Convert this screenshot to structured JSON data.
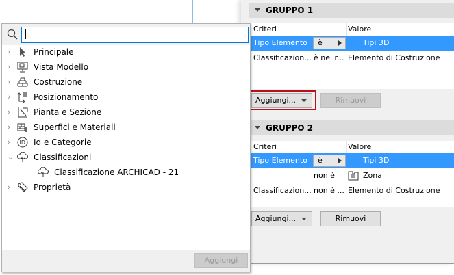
{
  "search": {
    "value": "",
    "placeholder": ""
  },
  "tree": [
    {
      "label": "Principale",
      "icon": "cursor-icon",
      "expanded": false
    },
    {
      "label": "Vista Modello",
      "icon": "monitor-icon",
      "expanded": false
    },
    {
      "label": "Costruzione",
      "icon": "bricks-icon",
      "expanded": false
    },
    {
      "label": "Posizionamento",
      "icon": "position-icon",
      "expanded": false
    },
    {
      "label": "Pianta e Sezione",
      "icon": "plan-section-icon",
      "expanded": false
    },
    {
      "label": "Superfici e Materiali",
      "icon": "materials-icon",
      "expanded": false
    },
    {
      "label": "Id e Categorie",
      "icon": "id-icon",
      "expanded": false
    },
    {
      "label": "Classificazioni",
      "icon": "tree-icon",
      "expanded": true
    },
    {
      "label": "Classificazione ARCHICAD - 21",
      "icon": "tree-icon",
      "child": true
    },
    {
      "label": "Proprietà",
      "icon": "tag-icon",
      "expanded": false
    }
  ],
  "popup_add": "Aggiungi",
  "groups": [
    {
      "title": "GRUPPO 1",
      "headers": [
        "Criteri",
        "",
        "Valore"
      ],
      "rows": [
        [
          "Tipo Elemento",
          "è",
          "Tipi 3D"
        ],
        [
          "Classificazion...",
          "è nel r...",
          "Elemento di Costruzione"
        ]
      ],
      "add": "Aggiungi...",
      "remove": "Rimuovi"
    },
    {
      "title": "GRUPPO 2",
      "headers": [
        "Criteri",
        "",
        "Valore"
      ],
      "rows": [
        [
          "Tipo Elemento",
          "è",
          "Tipi 3D"
        ],
        [
          "",
          "non è",
          "Zona"
        ],
        [
          "Classificazion...",
          "non è ...",
          "Elemento di Costruzione"
        ]
      ],
      "add": "Aggiungi...",
      "remove": "Rimuovi"
    }
  ],
  "colors": {
    "selection": "#3399ff",
    "highlight": "#b5121b"
  }
}
